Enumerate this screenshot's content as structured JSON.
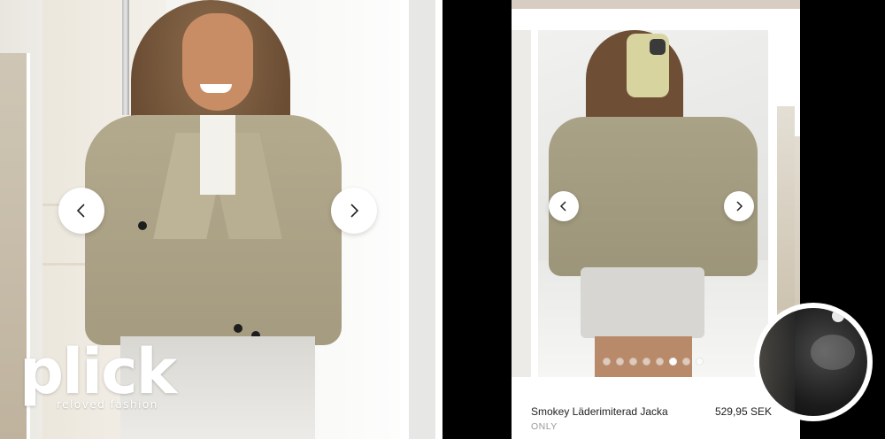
{
  "brand": {
    "logo_text": "plick",
    "tagline": "reloved fashion"
  },
  "left_panel": {
    "prev_icon": "chevron-left-icon",
    "next_icon": "chevron-right-icon"
  },
  "product": {
    "name": "Smokey Läderimiterad Jacka",
    "brand": "ONLY",
    "price": "529,95 SEK",
    "carousel": {
      "total_images": 8,
      "active_index": 5,
      "prev_icon": "chevron-left-icon",
      "next_icon": "chevron-right-icon"
    }
  },
  "colors": {
    "background": "#000000",
    "jacket": "#b3a98d",
    "phone_topbar": "#d7cdc2",
    "text": "#222222",
    "muted": "#9a9a9a"
  }
}
